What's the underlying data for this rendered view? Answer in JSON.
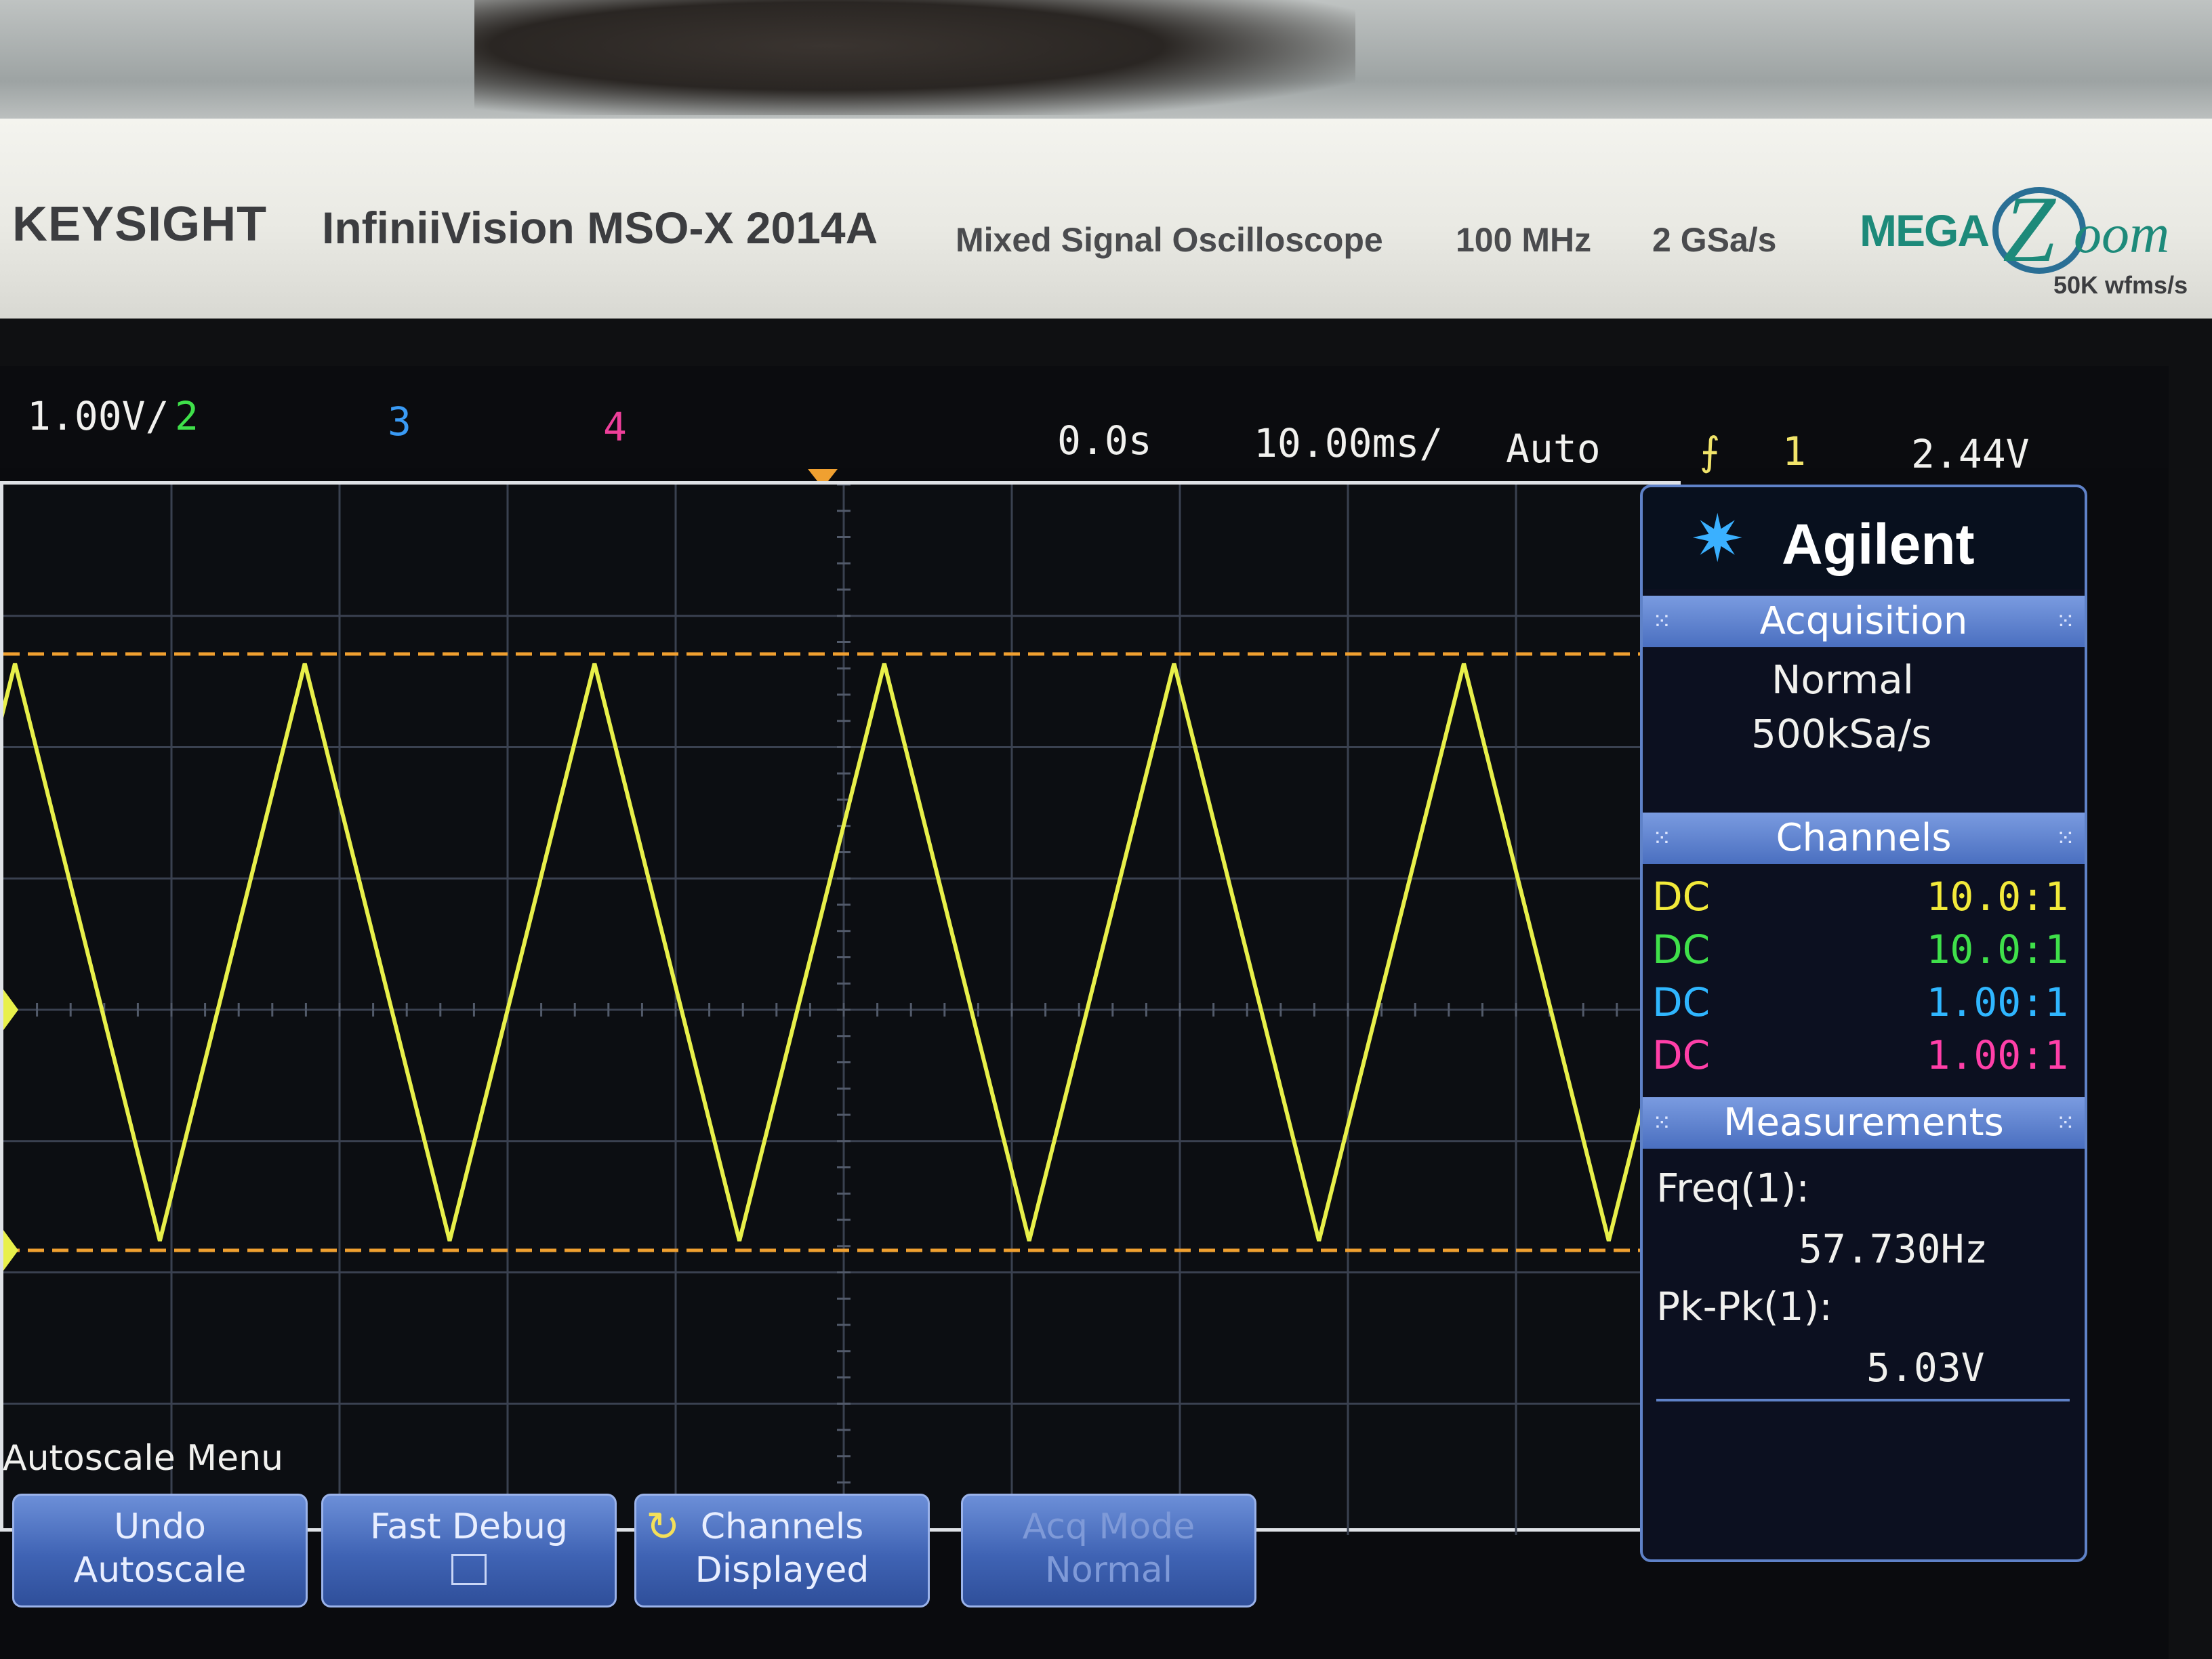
{
  "bezel": {
    "brand": "KEYSIGHT",
    "model": "InfiniiVision MSO-X 2014A",
    "description": "Mixed Signal Oscilloscope",
    "bandwidth": "100 MHz",
    "sample_rate": "2 GSa/s",
    "logo_mega": "MEGA",
    "logo_z": "Z",
    "logo_oom": "oom",
    "logo_wfms": "50K wfms/s"
  },
  "status_bar": {
    "ch1_scale": "1.00V/",
    "ch2_label": "2",
    "ch3_label": "3",
    "ch4_label": "4",
    "time_delay": "0.0s",
    "time_scale": "10.00ms/",
    "trigger_mode": "Auto",
    "trigger_slope_icon": "rising-edge-icon",
    "trigger_source": "1",
    "trigger_level": "2.44V"
  },
  "waveform": {
    "channel": "1",
    "shape": "triangle",
    "color": "#e8f04a",
    "cursor_color": "#f0a030",
    "cycles_visible": 5.8
  },
  "side_panel": {
    "logo": "Agilent",
    "acquisition": {
      "title": "Acquisition",
      "mode": "Normal",
      "rate": "500kSa/s"
    },
    "channels": {
      "title": "Channels",
      "rows": [
        {
          "coupling": "DC",
          "probe": "10.0:1",
          "color": "#f2ea3a"
        },
        {
          "coupling": "DC",
          "probe": "10.0:1",
          "color": "#3fe04a"
        },
        {
          "coupling": "DC",
          "probe": "1.00:1",
          "color": "#2fb6ff"
        },
        {
          "coupling": "DC",
          "probe": "1.00:1",
          "color": "#ff3fa8"
        }
      ]
    },
    "measurements": {
      "title": "Measurements",
      "items": [
        {
          "label": "Freq(1):",
          "value": "57.730Hz"
        },
        {
          "label": "Pk-Pk(1):",
          "value": "5.03V"
        }
      ]
    }
  },
  "softkeys": {
    "menu_title": "Autoscale Menu",
    "keys": [
      {
        "line1": "Undo",
        "line2": "Autoscale"
      },
      {
        "line1": "Fast Debug",
        "line2": ""
      },
      {
        "line1": "Channels",
        "line2": "Displayed"
      },
      {
        "line1": "Acq Mode",
        "line2": "Normal"
      }
    ]
  }
}
